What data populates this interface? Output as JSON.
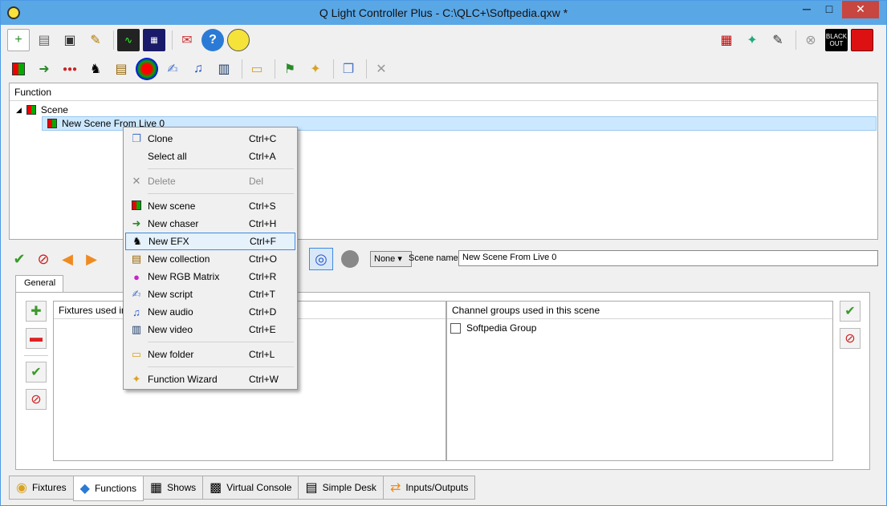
{
  "window": {
    "title": "Q Light Controller Plus - C:\\QLC+\\Softpedia.qxw *",
    "minimize": "─",
    "maximize": "□",
    "close": "✕"
  },
  "toolbar_main": {
    "left": [
      "new-file-icon",
      "print-icon",
      "save-icon",
      "edit-icon",
      "monitor-icon",
      "address-icon",
      "mail-icon",
      "help-icon",
      "about-icon"
    ],
    "right": [
      "addfixture-icon",
      "dmx-icon",
      "edit2-icon",
      "stop-icon",
      "blackout-icon",
      "record-icon"
    ],
    "blackout_label": "BLACK OUT"
  },
  "toolbar_functions": {
    "icons": [
      "scene-icon",
      "chaser-icon",
      "sequence-icon",
      "efx-icon",
      "collection-icon",
      "rgbmatrix-icon",
      "script-icon",
      "audio-icon",
      "video-icon",
      "folder-icon",
      "wizard-flag-icon",
      "wizard-wand-icon",
      "clone-icon",
      "delete-icon"
    ]
  },
  "function_tree": {
    "header": "Function",
    "folder": "Scene",
    "item": "New Scene From Live 0"
  },
  "context_menu": {
    "items": [
      {
        "label": "Clone",
        "shortcut": "Ctrl+C",
        "icon": "clone-icon"
      },
      {
        "label": "Select all",
        "shortcut": "Ctrl+A",
        "icon": ""
      },
      {
        "label": "Delete",
        "shortcut": "Del",
        "icon": "delete-icon"
      },
      {
        "label": "New scene",
        "shortcut": "Ctrl+S",
        "icon": "scene-icon"
      },
      {
        "label": "New chaser",
        "shortcut": "Ctrl+H",
        "icon": "chaser-icon"
      },
      {
        "label": "New EFX",
        "shortcut": "Ctrl+F",
        "icon": "efx-icon"
      },
      {
        "label": "New collection",
        "shortcut": "Ctrl+O",
        "icon": "collection-icon"
      },
      {
        "label": "New RGB Matrix",
        "shortcut": "Ctrl+R",
        "icon": "rgbmatrix-icon"
      },
      {
        "label": "New script",
        "shortcut": "Ctrl+T",
        "icon": "script-icon"
      },
      {
        "label": "New audio",
        "shortcut": "Ctrl+D",
        "icon": "audio-icon"
      },
      {
        "label": "New video",
        "shortcut": "Ctrl+E",
        "icon": "video-icon"
      },
      {
        "label": "New folder",
        "shortcut": "Ctrl+L",
        "icon": "folder-icon"
      },
      {
        "label": "Function Wizard",
        "shortcut": "Ctrl+W",
        "icon": "wizard-icon"
      }
    ]
  },
  "scene_editor": {
    "none_select": "None",
    "scene_name_label": "Scene name:",
    "scene_name_value": "New Scene From Live 0",
    "tab_general": "General",
    "fixtures_header": "Fixtures used in",
    "channel_groups_header": "Channel groups used in this scene",
    "channel_groups": [
      "Softpedia Group"
    ]
  },
  "bottom_tabs": [
    {
      "label": "Fixtures",
      "icon": "fixture-icon"
    },
    {
      "label": "Functions",
      "icon": "functions-icon",
      "active": true
    },
    {
      "label": "Shows",
      "icon": "shows-icon"
    },
    {
      "label": "Virtual Console",
      "icon": "virtualconsole-icon"
    },
    {
      "label": "Simple Desk",
      "icon": "simpledesk-icon"
    },
    {
      "label": "Inputs/Outputs",
      "icon": "io-icon"
    }
  ]
}
